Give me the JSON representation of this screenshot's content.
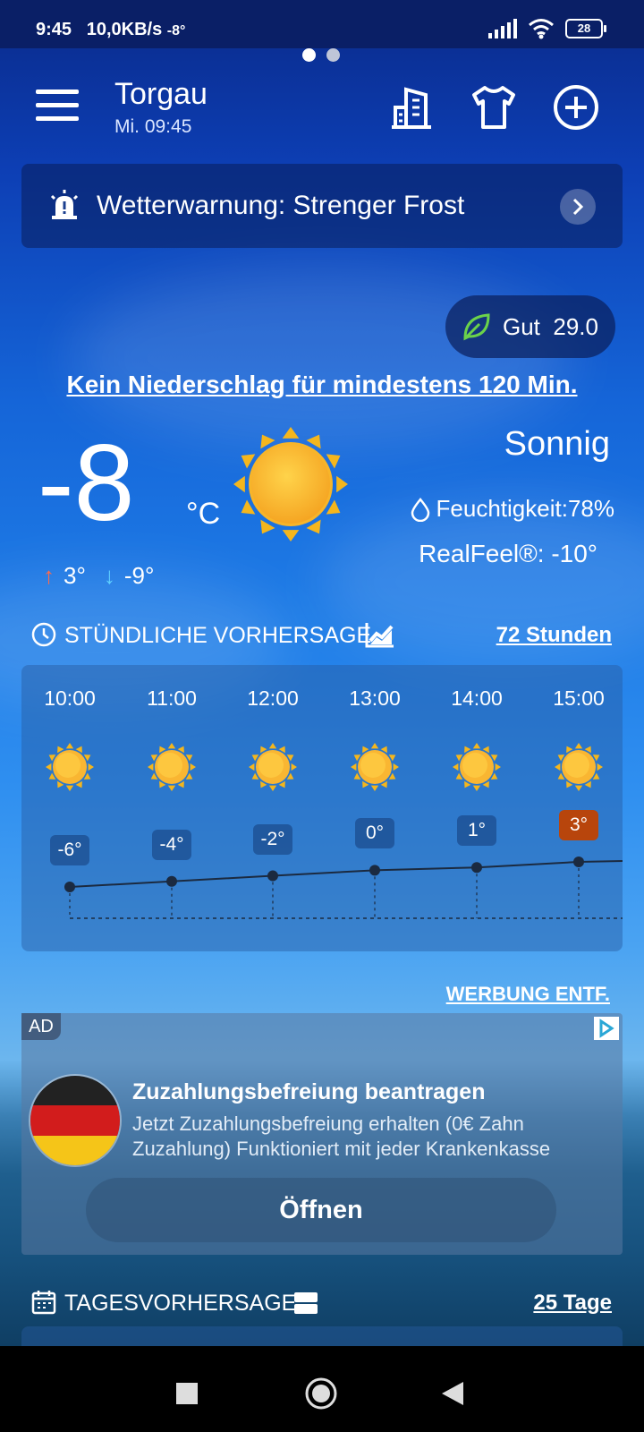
{
  "status_bar": {
    "time": "9:45",
    "network": "10,0KB/s",
    "temp": "-8°",
    "battery": "28"
  },
  "header": {
    "city": "Torgau",
    "datetime": "Mi. 09:45"
  },
  "warning": {
    "text": "Wetterwarnung: Strenger Frost"
  },
  "air_quality": {
    "label": "Gut",
    "value": "29.0"
  },
  "nowcast": "Kein Niederschlag für mindestens 120 Min.",
  "current": {
    "temp": "-8",
    "unit": "°C",
    "high": "3°",
    "low": "-9°",
    "condition": "Sonnig",
    "humidity": "Feuchtigkeit:78%",
    "realfeel": "RealFeel®: -10°"
  },
  "hourly_section": {
    "title": "STÜNDLICHE VORHERSAGE",
    "link": "72 Stunden"
  },
  "hourly": [
    {
      "time": "10:00",
      "temp": "-6°",
      "value": -6
    },
    {
      "time": "11:00",
      "temp": "-4°",
      "value": -4
    },
    {
      "time": "12:00",
      "temp": "-2°",
      "value": -2
    },
    {
      "time": "13:00",
      "temp": "0°",
      "value": 0
    },
    {
      "time": "14:00",
      "temp": "1°",
      "value": 1
    },
    {
      "time": "15:00",
      "temp": "3°",
      "value": 3
    }
  ],
  "ad": {
    "remove_label": "WERBUNG ENTF.",
    "badge": "AD",
    "title": "Zuzahlungsbefreiung beantragen",
    "description": "Jetzt Zuzahlungsbefreiung erhalten (0€ Zahn Zuzahlung) Funktioniert mit jeder Krankenkasse",
    "button": "Öffnen"
  },
  "daily_section": {
    "title": "TAGESVORHERSAGE",
    "link": "25 Tage"
  },
  "colors": {
    "high_arrow": "#ff6a4a",
    "low_arrow": "#5fd0ff",
    "max_badge": "#b8450c",
    "leaf": "#6bd24a"
  }
}
